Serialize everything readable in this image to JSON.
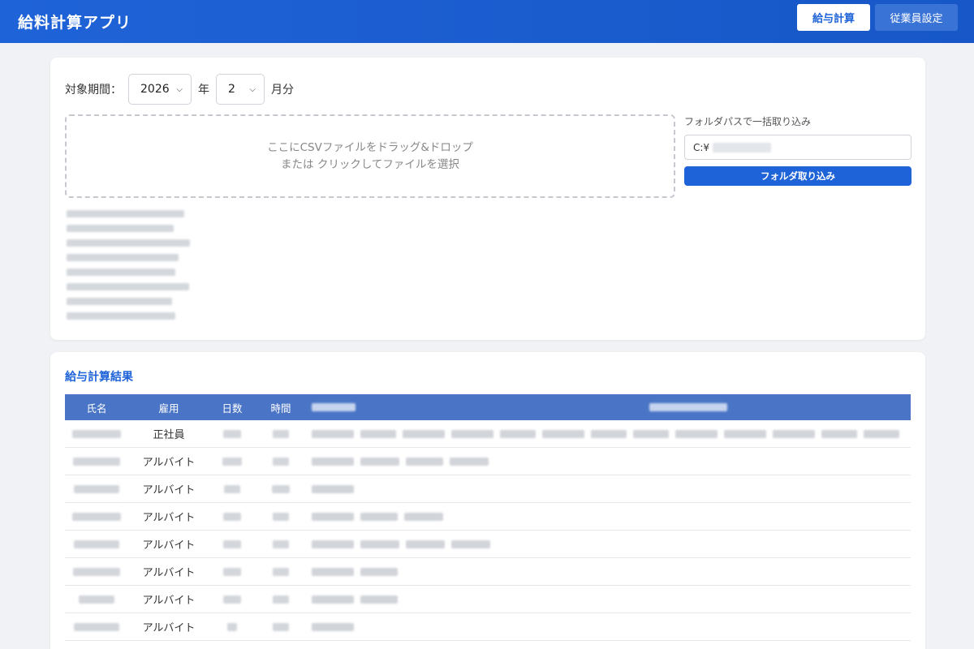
{
  "header": {
    "title": "給料計算アプリ",
    "nav": [
      {
        "label": "給与計算",
        "active": true
      },
      {
        "label": "従業員設定",
        "active": false
      }
    ]
  },
  "period": {
    "label": "対象期間：",
    "year": "2026",
    "year_suffix": "年",
    "month": "2",
    "month_suffix": "月分"
  },
  "dropzone": {
    "line1": "ここにCSVファイルをドラッグ&ドロップ",
    "line2": "または クリックしてファイルを選択"
  },
  "folder": {
    "label": "フォルダパスで一括取り込み",
    "value_prefix": "C:¥",
    "button": "フォルダ取り込み"
  },
  "results": {
    "title": "給与計算結果",
    "columns": [
      "氏名",
      "雇用",
      "日数",
      "時間"
    ],
    "rows": [
      {
        "type": "正社員"
      },
      {
        "type": "アルバイト"
      },
      {
        "type": "アルバイト"
      },
      {
        "type": "アルバイト"
      },
      {
        "type": "アルバイト"
      },
      {
        "type": "アルバイト"
      },
      {
        "type": "アルバイト"
      },
      {
        "type": "アルバイト"
      }
    ]
  },
  "colors": {
    "primary": "#1f63d8",
    "table_header": "#4a75c6",
    "background": "#f0f2f5"
  }
}
